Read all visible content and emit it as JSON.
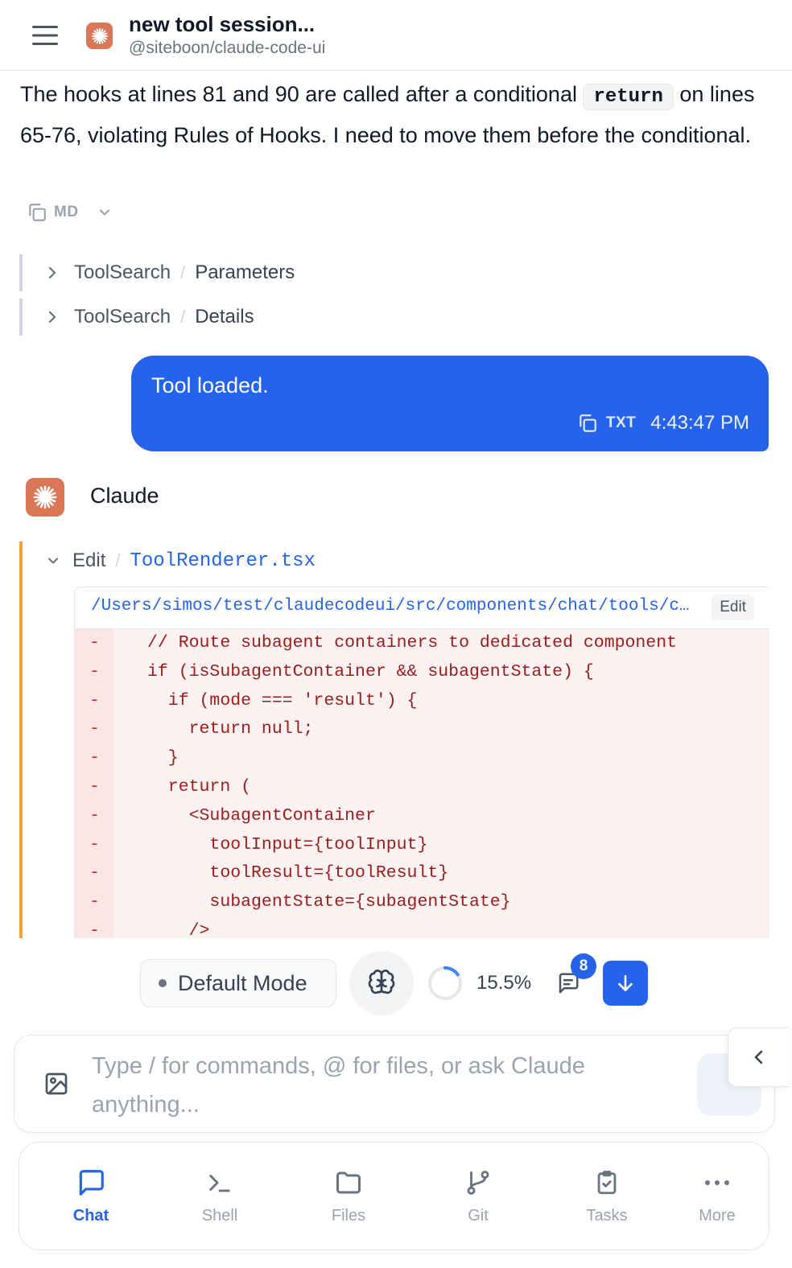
{
  "header": {
    "title": "new tool session...",
    "subtitle": "@siteboon/claude-code-ui"
  },
  "assistant_message": {
    "text_before": "The hooks at lines 81 and 90 are called after a conditional ",
    "inline_code": "return",
    "text_after": " on lines 65-76, violating Rules of Hooks. I need to move them before the conditional.",
    "copy_format": "MD"
  },
  "tool_rows": [
    {
      "name": "ToolSearch",
      "section": "Parameters"
    },
    {
      "name": "ToolSearch",
      "section": "Details"
    }
  ],
  "user_message": {
    "text": "Tool loaded.",
    "copy_format": "TXT",
    "time": "4:43:47 PM"
  },
  "claude": {
    "name": "Claude"
  },
  "edit_tool": {
    "name": "Edit",
    "file": "ToolRenderer.tsx",
    "path": "/Users/simos/test/claudecodeui/src/components/chat/tools/components/ToolRenderer.tsx",
    "edit_label": "Edit",
    "removed_lines": [
      "// Route subagent containers to dedicated component",
      "if (isSubagentContainer && subagentState) {",
      "  if (mode === 'result') {",
      "    return null;",
      "  }",
      "  return (",
      "    <SubagentContainer",
      "      toolInput={toolInput}",
      "      toolResult={toolResult}",
      "      subagentState={subagentState}",
      "    />"
    ],
    "marker": "-"
  },
  "status_bar": {
    "mode_label": "Default Mode",
    "context_percent": "15.5%",
    "context_fraction": 0.155,
    "message_count": "8"
  },
  "input": {
    "placeholder": "Type / for commands, @ for files, or ask Claude anything..."
  },
  "nav": {
    "items": [
      {
        "label": "Chat",
        "icon": "chat-icon",
        "active": true
      },
      {
        "label": "Shell",
        "icon": "terminal-icon",
        "active": false
      },
      {
        "label": "Files",
        "icon": "folder-icon",
        "active": false
      },
      {
        "label": "Git",
        "icon": "git-branch-icon",
        "active": false
      },
      {
        "label": "Tasks",
        "icon": "clipboard-icon",
        "active": false
      },
      {
        "label": "More",
        "icon": "more-icon",
        "active": false
      }
    ]
  },
  "colors": {
    "accent": "#2563eb",
    "claude_brand": "#d97757",
    "edit_border": "#f0a23b",
    "diff_removed_text": "#9b1c1c"
  }
}
